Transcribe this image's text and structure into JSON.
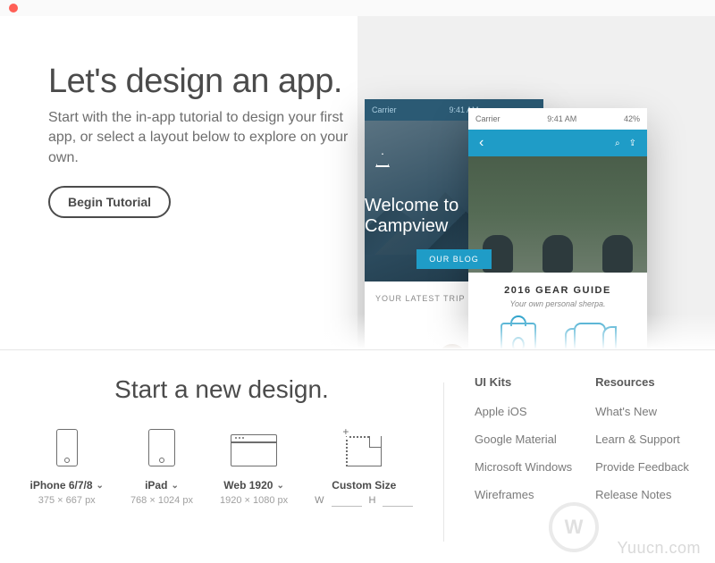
{
  "hero": {
    "title": "Let's design an app.",
    "subtitle": "Start with the in-app tutorial to design your first app, or select a layout below to explore on your own.",
    "begin_label": "Begin Tutorial"
  },
  "mock_back": {
    "carrier": "Carrier",
    "time": "9:41 AM",
    "welcome": "Welcome to Campview",
    "blog_btn": "OUR BLOG",
    "latest": "YOUR LATEST TRIP"
  },
  "mock_front": {
    "carrier": "Carrier",
    "time": "9:41 AM",
    "battery": "42%",
    "title": "2016 GEAR GUIDE",
    "subtitle": "Your own personal sherpa."
  },
  "new_design_title": "Start a new design.",
  "presets": [
    {
      "label": "iPhone 6/7/8",
      "dim": "375 × 667 px",
      "has_chev": true
    },
    {
      "label": "iPad",
      "dim": "768 × 1024 px",
      "has_chev": true
    },
    {
      "label": "Web 1920",
      "dim": "1920 × 1080 px",
      "has_chev": true
    },
    {
      "label": "Custom Size",
      "dim": "",
      "has_chev": false
    }
  ],
  "custom_wh": {
    "w": "W",
    "h": "H"
  },
  "linkcols": [
    {
      "title": "UI Kits",
      "items": [
        "Apple iOS",
        "Google Material",
        "Microsoft Windows",
        "Wireframes"
      ]
    },
    {
      "title": "Resources",
      "items": [
        "What's New",
        "Learn & Support",
        "Provide Feedback",
        "Release Notes"
      ]
    }
  ],
  "watermark": "Yuucn.com"
}
